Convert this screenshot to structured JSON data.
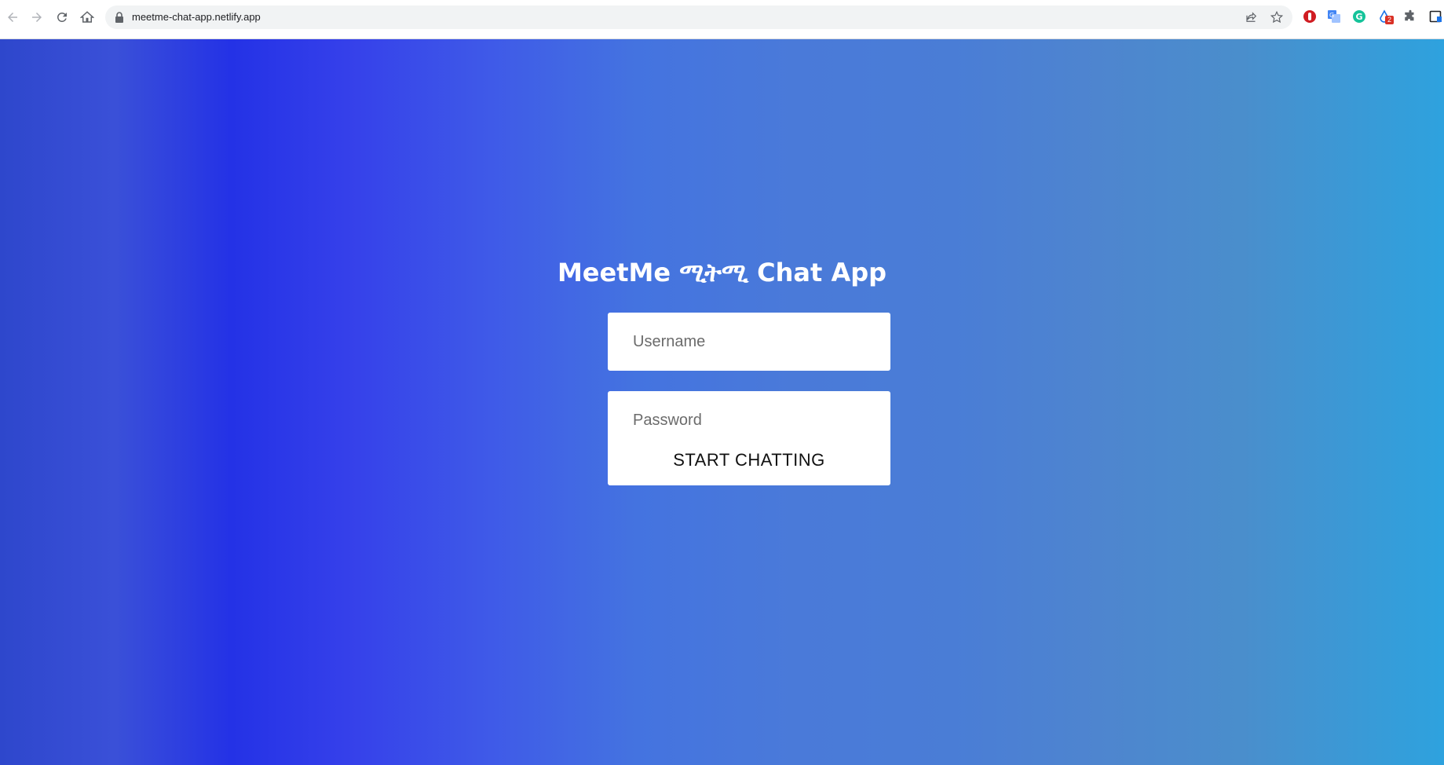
{
  "browser": {
    "url": "meetme-chat-app.netlify.app",
    "extension_badge_count": "2",
    "icons": [
      "back-icon",
      "forward-icon",
      "reload-icon",
      "home-icon",
      "lock-icon",
      "share-icon",
      "bookmark-star-icon",
      "adblock-icon",
      "translate-icon",
      "grammarly-icon",
      "extension-badge-icon",
      "puzzle-icon",
      "sidebar-icon"
    ]
  },
  "app": {
    "title": "MeetMe ሚትሚ Chat App",
    "username_placeholder": "Username",
    "password_placeholder": "Password",
    "submit_label": "START CHATTING"
  },
  "colors": {
    "gradient_start": "#2e47cc",
    "gradient_mid": "#2432e6",
    "gradient_end": "#2ea2de",
    "text": "#ffffff",
    "field_bg": "#ffffff"
  }
}
